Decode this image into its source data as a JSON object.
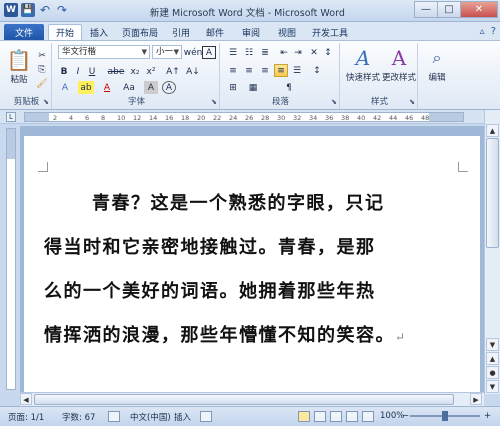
{
  "window": {
    "title": "新建 Microsoft Word 文档 - Microsoft Word",
    "controls": {
      "minimize": "—",
      "maximize": "□",
      "close": "✕"
    },
    "qat": {
      "logo": "W",
      "save": "💾",
      "undo": "↶",
      "redo": "↷"
    }
  },
  "tabs": {
    "file": "文件",
    "items": [
      "开始",
      "插入",
      "页面布局",
      "引用",
      "邮件",
      "审阅",
      "视图",
      "开发工具"
    ],
    "active": "开始",
    "right_icons": [
      "▵",
      "?"
    ]
  },
  "ribbon": {
    "clipboard": {
      "label": "剪贴板",
      "paste": "粘贴",
      "paste_icon": "📋"
    },
    "font": {
      "label": "字体",
      "font_name": "华文行楷",
      "font_size": "小一",
      "buttons": [
        "B",
        "I",
        "U",
        "abe",
        "x₂",
        "x²"
      ],
      "grow": "A↑",
      "shrink": "A↓",
      "clear": "Aa",
      "wen": "wén",
      "char_border": "A",
      "row3": [
        "A",
        "ab",
        "A",
        "Aa",
        "A",
        "A"
      ]
    },
    "paragraph": {
      "label": "段落",
      "row1": [
        "☰",
        "☷",
        "≣",
        "⇤",
        "⇥",
        "✕",
        "↕",
        "¶"
      ],
      "row2": [
        "≡",
        "≡",
        "≡",
        "≡",
        "☰",
        "↕"
      ],
      "row3": [
        "⊞",
        "▦"
      ]
    },
    "styles": {
      "label": "样式",
      "quick": "快速样式",
      "change": "更改样式"
    },
    "editing": {
      "label": "编辑"
    }
  },
  "ruler": {
    "ticks": [
      "2",
      "4",
      "6",
      "8",
      "10",
      "12",
      "14",
      "16",
      "18",
      "20",
      "22",
      "24",
      "26",
      "28",
      "30",
      "32",
      "34",
      "36",
      "38",
      "40",
      "42",
      "44",
      "46",
      "48"
    ]
  },
  "document": {
    "lines": [
      "青春？这是一个熟悉的字眼，只记",
      "得当时和它亲密地接触过。青春，是那",
      "么的一个美好的词语。她拥着那些年热",
      "情挥洒的浪漫，那些年懵懂不知的笑容。"
    ],
    "para_mark": "↵"
  },
  "status": {
    "page": "页面: 1/1",
    "words": "字数: 67",
    "language": "中文(中国)",
    "insert": "插入",
    "zoom": "100%",
    "zoom_minus": "−",
    "zoom_plus": "+"
  }
}
